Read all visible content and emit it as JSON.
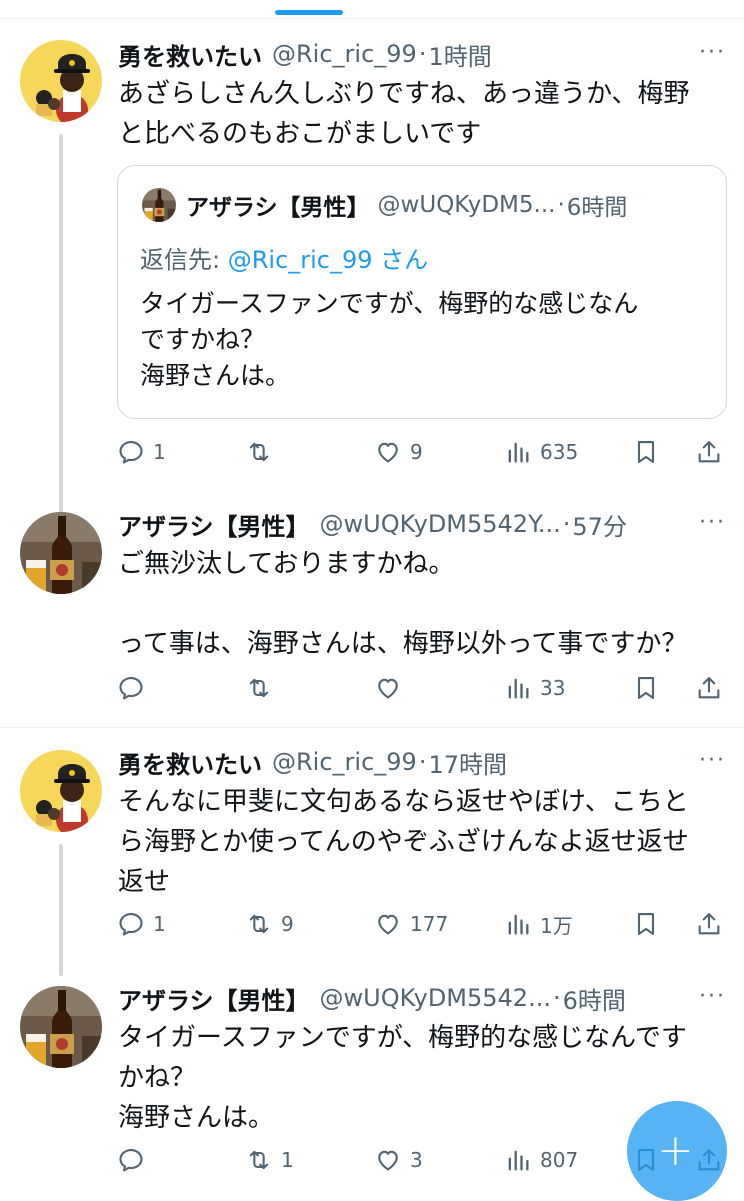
{
  "tweets": [
    {
      "name": "勇を救いたい",
      "handle": "@Ric_ric_99",
      "sep": "·",
      "time": "1時間",
      "more": "···",
      "text": "あざらしさん久しぶりですね、あっ違うか、梅野\nと比べるのもおこがましいです",
      "quote": {
        "name": "アザラシ【男性】",
        "handle": "@wUQKyDM5...",
        "sep": "·",
        "time": "6時間",
        "reply_prefix": "返信先: ",
        "reply_to": "@Ric_ric_99 さん",
        "text": "タイガースファンですが、梅野的な感じなん\nですかね？\n海野さんは。"
      },
      "replies": "1",
      "retweets": "",
      "likes": "9",
      "views": "635"
    },
    {
      "name": "アザラシ【男性】",
      "handle": "@wUQKyDM5542Y...",
      "sep": "·",
      "time": "57分",
      "more": "···",
      "text": "ご無沙汰しておりますかね。\n\nって事は、海野さんは、梅野以外って事ですか？",
      "replies": "",
      "retweets": "",
      "likes": "",
      "views": "33"
    },
    {
      "name": "勇を救いたい",
      "handle": "@Ric_ric_99",
      "sep": "·",
      "time": "17時間",
      "more": "···",
      "text": "そんなに甲斐に文句あるなら返せやぼけ、こちと\nら海野とか使ってんのやぞふざけんなよ返せ返せ\n返せ",
      "replies": "1",
      "retweets": "9",
      "likes": "177",
      "views": "1万"
    },
    {
      "name": "アザラシ【男性】",
      "handle": "@wUQKyDM5542...",
      "sep": "·",
      "time": "6時間",
      "more": "···",
      "text": "タイガースファンですが、梅野的な感じなんです\nかね？\n海野さんは。",
      "replies": "",
      "retweets": "1",
      "likes": "3",
      "views": "807"
    }
  ],
  "fab": {
    "label": "+"
  },
  "colors": {
    "accent": "#1d9bf0",
    "secondary_text": "#536471",
    "border": "#cfd9de"
  },
  "icons": [
    "reply-icon",
    "retweet-icon",
    "like-icon",
    "views-icon",
    "bookmark-icon",
    "share-icon",
    "more-icon"
  ]
}
